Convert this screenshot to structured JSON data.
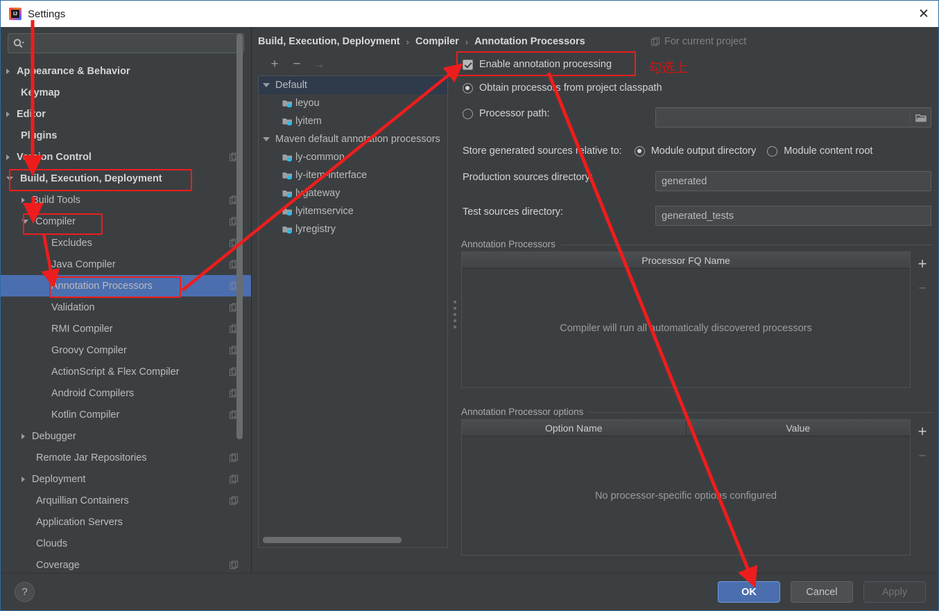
{
  "window": {
    "title": "Settings",
    "app_icon": "intellij-idea-icon",
    "close_label": "✕"
  },
  "search": {
    "value": "",
    "placeholder": "",
    "icon": "search-icon"
  },
  "sidebar": {
    "items": [
      {
        "label": "Appearance & Behavior",
        "indent": 0,
        "arrow": "closed",
        "bold": true,
        "project_icon": false,
        "selected": false
      },
      {
        "label": "Keymap",
        "indent": 0,
        "arrow": "none",
        "bold": true,
        "project_icon": false,
        "selected": false
      },
      {
        "label": "Editor",
        "indent": 0,
        "arrow": "closed",
        "bold": true,
        "project_icon": false,
        "selected": false
      },
      {
        "label": "Plugins",
        "indent": 0,
        "arrow": "none",
        "bold": true,
        "project_icon": false,
        "selected": false
      },
      {
        "label": "Version Control",
        "indent": 0,
        "arrow": "closed",
        "bold": true,
        "project_icon": true,
        "selected": false
      },
      {
        "label": "Build, Execution, Deployment",
        "indent": 0,
        "arrow": "open",
        "bold": true,
        "project_icon": false,
        "selected": false
      },
      {
        "label": "Build Tools",
        "indent": 1,
        "arrow": "closed",
        "bold": false,
        "project_icon": true,
        "selected": false
      },
      {
        "label": "Compiler",
        "indent": 1,
        "arrow": "open",
        "bold": false,
        "project_icon": true,
        "selected": false
      },
      {
        "label": "Excludes",
        "indent": 2,
        "arrow": "none",
        "bold": false,
        "project_icon": true,
        "selected": false
      },
      {
        "label": "Java Compiler",
        "indent": 2,
        "arrow": "none",
        "bold": false,
        "project_icon": true,
        "selected": false
      },
      {
        "label": "Annotation Processors",
        "indent": 2,
        "arrow": "none",
        "bold": false,
        "project_icon": true,
        "selected": true
      },
      {
        "label": "Validation",
        "indent": 2,
        "arrow": "none",
        "bold": false,
        "project_icon": true,
        "selected": false
      },
      {
        "label": "RMI Compiler",
        "indent": 2,
        "arrow": "none",
        "bold": false,
        "project_icon": true,
        "selected": false
      },
      {
        "label": "Groovy Compiler",
        "indent": 2,
        "arrow": "none",
        "bold": false,
        "project_icon": true,
        "selected": false
      },
      {
        "label": "ActionScript & Flex Compiler",
        "indent": 2,
        "arrow": "none",
        "bold": false,
        "project_icon": true,
        "selected": false
      },
      {
        "label": "Android Compilers",
        "indent": 2,
        "arrow": "none",
        "bold": false,
        "project_icon": true,
        "selected": false
      },
      {
        "label": "Kotlin Compiler",
        "indent": 2,
        "arrow": "none",
        "bold": false,
        "project_icon": true,
        "selected": false
      },
      {
        "label": "Debugger",
        "indent": 1,
        "arrow": "closed",
        "bold": false,
        "project_icon": false,
        "selected": false
      },
      {
        "label": "Remote Jar Repositories",
        "indent": 1,
        "arrow": "none",
        "bold": false,
        "project_icon": true,
        "selected": false
      },
      {
        "label": "Deployment",
        "indent": 1,
        "arrow": "closed",
        "bold": false,
        "project_icon": true,
        "selected": false
      },
      {
        "label": "Arquillian Containers",
        "indent": 1,
        "arrow": "none",
        "bold": false,
        "project_icon": true,
        "selected": false
      },
      {
        "label": "Application Servers",
        "indent": 1,
        "arrow": "none",
        "bold": false,
        "project_icon": false,
        "selected": false
      },
      {
        "label": "Clouds",
        "indent": 1,
        "arrow": "none",
        "bold": false,
        "project_icon": false,
        "selected": false
      },
      {
        "label": "Coverage",
        "indent": 1,
        "arrow": "none",
        "bold": false,
        "project_icon": true,
        "selected": false
      }
    ]
  },
  "breadcrumb": {
    "parts": [
      "Build, Execution, Deployment",
      "Compiler",
      "Annotation Processors"
    ],
    "separator": "›"
  },
  "for_current_project": {
    "label": "For current project",
    "icon": "project-scope-icon"
  },
  "profiles": {
    "toolbar": {
      "add": "+",
      "remove": "−",
      "move": "→"
    },
    "rows": [
      {
        "label": "Default",
        "type": "profile",
        "arrow": "open",
        "indent": 0,
        "selected": true
      },
      {
        "label": "leyou",
        "type": "module",
        "arrow": "none",
        "indent": 1,
        "selected": false
      },
      {
        "label": "lyitem",
        "type": "module",
        "arrow": "none",
        "indent": 1,
        "selected": false
      },
      {
        "label": "Maven default annotation processors",
        "type": "profile",
        "arrow": "open",
        "indent": 0,
        "selected": false
      },
      {
        "label": "ly-common",
        "type": "module",
        "arrow": "none",
        "indent": 1,
        "selected": false
      },
      {
        "label": "ly-item-interface",
        "type": "module",
        "arrow": "none",
        "indent": 1,
        "selected": false
      },
      {
        "label": "lygateway",
        "type": "module",
        "arrow": "none",
        "indent": 1,
        "selected": false
      },
      {
        "label": "lyitemservice",
        "type": "module",
        "arrow": "none",
        "indent": 1,
        "selected": false
      },
      {
        "label": "lyregistry",
        "type": "module",
        "arrow": "none",
        "indent": 1,
        "selected": false
      }
    ]
  },
  "form": {
    "enable_annotation_processing": {
      "label": "Enable annotation processing",
      "checked": true
    },
    "processor_source": {
      "selected": "classpath",
      "options": [
        {
          "id": "classpath",
          "label": "Obtain processors from project classpath"
        },
        {
          "id": "path",
          "label": "Processor path:"
        }
      ],
      "processor_path_value": "",
      "browse_icon": "folder-icon"
    },
    "store_relative": {
      "label": "Store generated sources relative to:",
      "selected": "module_output",
      "options": [
        {
          "id": "module_output",
          "label": "Module output directory"
        },
        {
          "id": "module_content",
          "label": "Module content root"
        }
      ]
    },
    "production_sources": {
      "label": "Production sources directory:",
      "value": "generated"
    },
    "test_sources": {
      "label": "Test sources directory:",
      "value": "generated_tests"
    }
  },
  "processors_table": {
    "group_title": "Annotation Processors",
    "columns": [
      "Processor FQ Name"
    ],
    "rows": [],
    "empty_message": "Compiler will run all automatically discovered processors",
    "add_label": "+",
    "remove_label": "−"
  },
  "options_table": {
    "group_title": "Annotation Processor options",
    "columns": [
      "Option Name",
      "Value"
    ],
    "rows": [],
    "empty_message": "No processor-specific options configured",
    "add_label": "+",
    "remove_label": "−"
  },
  "footer": {
    "help_label": "?",
    "ok_label": "OK",
    "cancel_label": "Cancel",
    "apply_label": "Apply"
  },
  "annotations": {
    "note_cn": "勾选上",
    "color": "#ee1d1d"
  }
}
